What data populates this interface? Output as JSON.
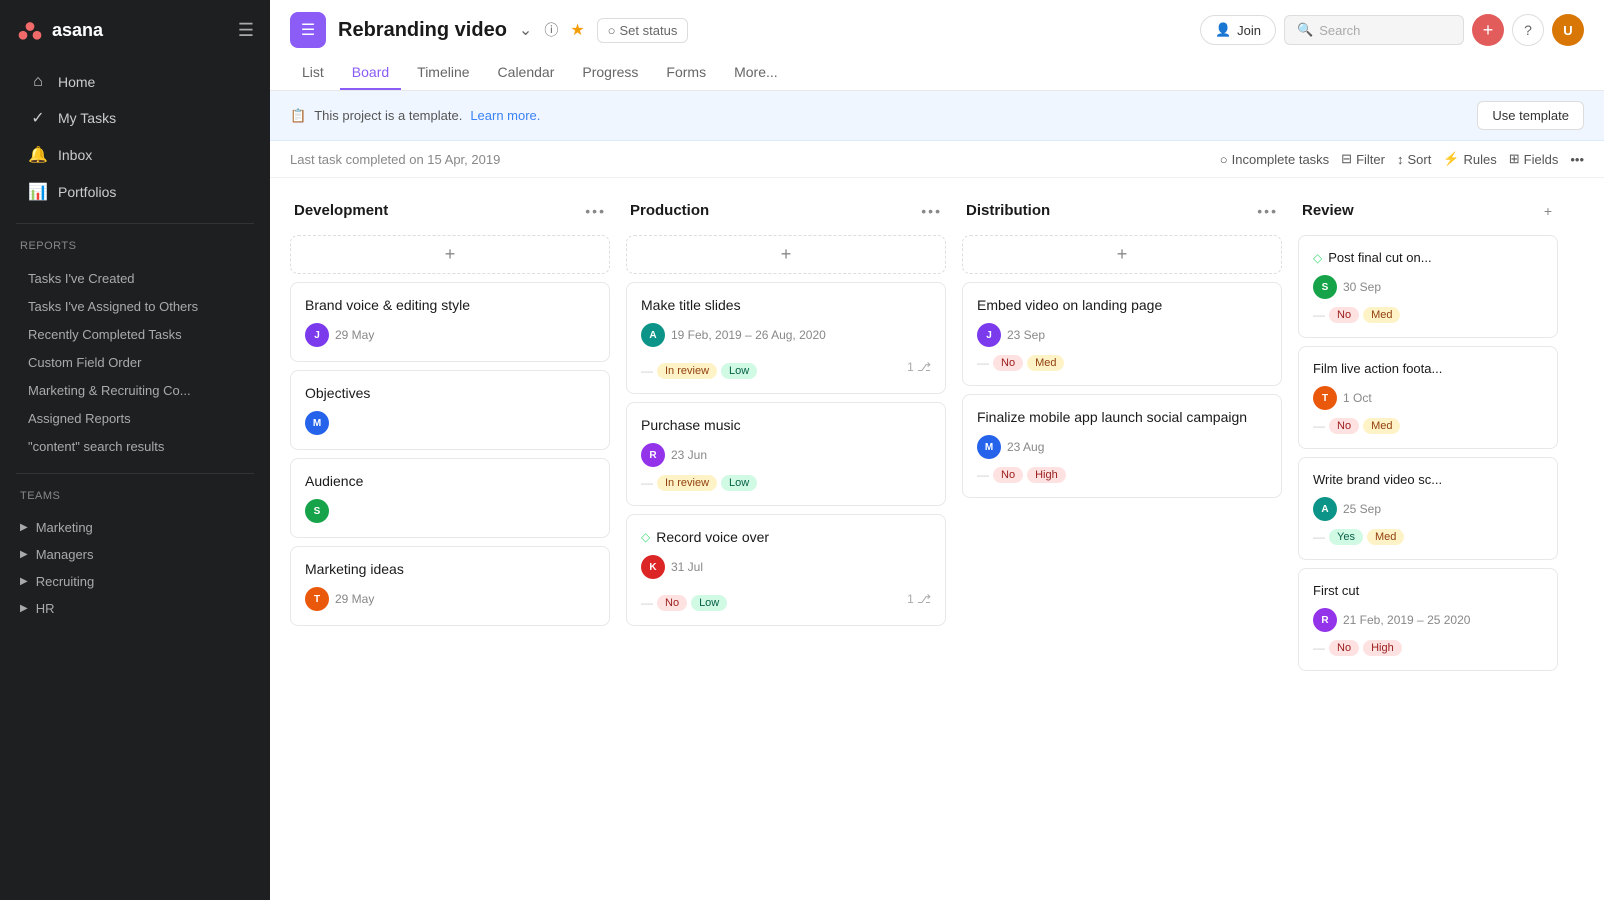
{
  "sidebar": {
    "logo_text": "asana",
    "nav_items": [
      {
        "id": "home",
        "label": "Home",
        "icon": "⌂"
      },
      {
        "id": "my-tasks",
        "label": "My Tasks",
        "icon": "✓"
      },
      {
        "id": "inbox",
        "label": "Inbox",
        "icon": "🔔"
      },
      {
        "id": "portfolios",
        "label": "Portfolios",
        "icon": "📊"
      }
    ],
    "reports_title": "Reports",
    "report_items": [
      "Tasks I've Created",
      "Tasks I've Assigned to Others",
      "Recently Completed Tasks",
      "Custom Field Order",
      "Marketing & Recruiting Co...",
      "Assigned Reports",
      "\"content\" search results"
    ],
    "teams_title": "Teams",
    "team_items": [
      "Marketing",
      "Managers",
      "Recruiting",
      "HR"
    ]
  },
  "header": {
    "project_icon": "☰",
    "project_title": "Rebranding video",
    "join_label": "Join",
    "set_status_label": "Set status",
    "search_placeholder": "Search",
    "tabs": [
      "List",
      "Board",
      "Timeline",
      "Calendar",
      "Progress",
      "Forms",
      "More..."
    ],
    "active_tab": "Board"
  },
  "banner": {
    "message": "This project is a template.",
    "learn_more": "Learn more.",
    "use_template": "Use template"
  },
  "toolbar": {
    "last_task": "Last task completed on 15 Apr, 2019",
    "incomplete_tasks": "Incomplete tasks",
    "filter": "Filter",
    "sort": "Sort",
    "rules": "Rules",
    "fields": "Fields"
  },
  "columns": [
    {
      "id": "development",
      "title": "Development",
      "cards": [
        {
          "id": "brand-voice",
          "title": "Brand voice & editing style",
          "avatar": "av1",
          "avatar_initials": "J",
          "date": "29 May",
          "tags": [],
          "subtasks": null,
          "diamond": false
        },
        {
          "id": "objectives",
          "title": "Objectives",
          "avatar": "av2",
          "avatar_initials": "M",
          "date": "",
          "tags": [],
          "subtasks": null,
          "diamond": false
        },
        {
          "id": "audience",
          "title": "Audience",
          "avatar": "av3",
          "avatar_initials": "S",
          "date": "",
          "tags": [],
          "subtasks": null,
          "diamond": false
        },
        {
          "id": "marketing-ideas",
          "title": "Marketing ideas",
          "avatar": "av4",
          "avatar_initials": "T",
          "date": "29 May",
          "tags": [],
          "subtasks": null,
          "diamond": false
        }
      ]
    },
    {
      "id": "production",
      "title": "Production",
      "cards": [
        {
          "id": "make-title-slides",
          "title": "Make title slides",
          "avatar": "av5",
          "avatar_initials": "A",
          "date": "19 Feb, 2019 – 26 Aug, 2020",
          "tags": [
            "In review",
            "Low"
          ],
          "subtasks": "1",
          "diamond": false
        },
        {
          "id": "purchase-music",
          "title": "Purchase music",
          "avatar": "av6",
          "avatar_initials": "R",
          "date": "23 Jun",
          "tags": [
            "In review",
            "Low"
          ],
          "subtasks": null,
          "diamond": false
        },
        {
          "id": "record-voice-over",
          "title": "Record voice over",
          "avatar": "av7",
          "avatar_initials": "K",
          "date": "31 Jul",
          "tags": [
            "No",
            "Low"
          ],
          "subtasks": "1",
          "diamond": true
        }
      ]
    },
    {
      "id": "distribution",
      "title": "Distribution",
      "cards": [
        {
          "id": "embed-video",
          "title": "Embed video on landing page",
          "avatar": "av1",
          "avatar_initials": "J",
          "date": "23 Sep",
          "tags": [
            "No",
            "Med"
          ],
          "subtasks": null,
          "diamond": false
        },
        {
          "id": "finalize-mobile",
          "title": "Finalize mobile app launch social campaign",
          "avatar": "av2",
          "avatar_initials": "M",
          "date": "23 Aug",
          "tags": [
            "No",
            "High"
          ],
          "subtasks": null,
          "diamond": false
        }
      ]
    },
    {
      "id": "review",
      "title": "Review",
      "cards": [
        {
          "id": "post-final-cut",
          "title": "Post final cut on...",
          "avatar": "av3",
          "avatar_initials": "S",
          "date": "30 Sep",
          "tags": [
            "No",
            "Med"
          ],
          "subtasks": null,
          "diamond": true
        },
        {
          "id": "film-live-action",
          "title": "Film live action foota...",
          "avatar": "av4",
          "avatar_initials": "T",
          "date": "1 Oct",
          "tags": [
            "No",
            "Med"
          ],
          "subtasks": null,
          "diamond": false
        },
        {
          "id": "write-brand-video",
          "title": "Write brand video sc...",
          "avatar": "av5",
          "avatar_initials": "A",
          "date": "25 Sep",
          "tags": [
            "Yes",
            "Med"
          ],
          "subtasks": null,
          "diamond": false
        },
        {
          "id": "first-cut",
          "title": "First cut",
          "avatar": "av6",
          "avatar_initials": "R",
          "date": "21 Feb, 2019 – 25 2020",
          "tags": [
            "No",
            "High"
          ],
          "subtasks": null,
          "diamond": false
        }
      ]
    }
  ]
}
